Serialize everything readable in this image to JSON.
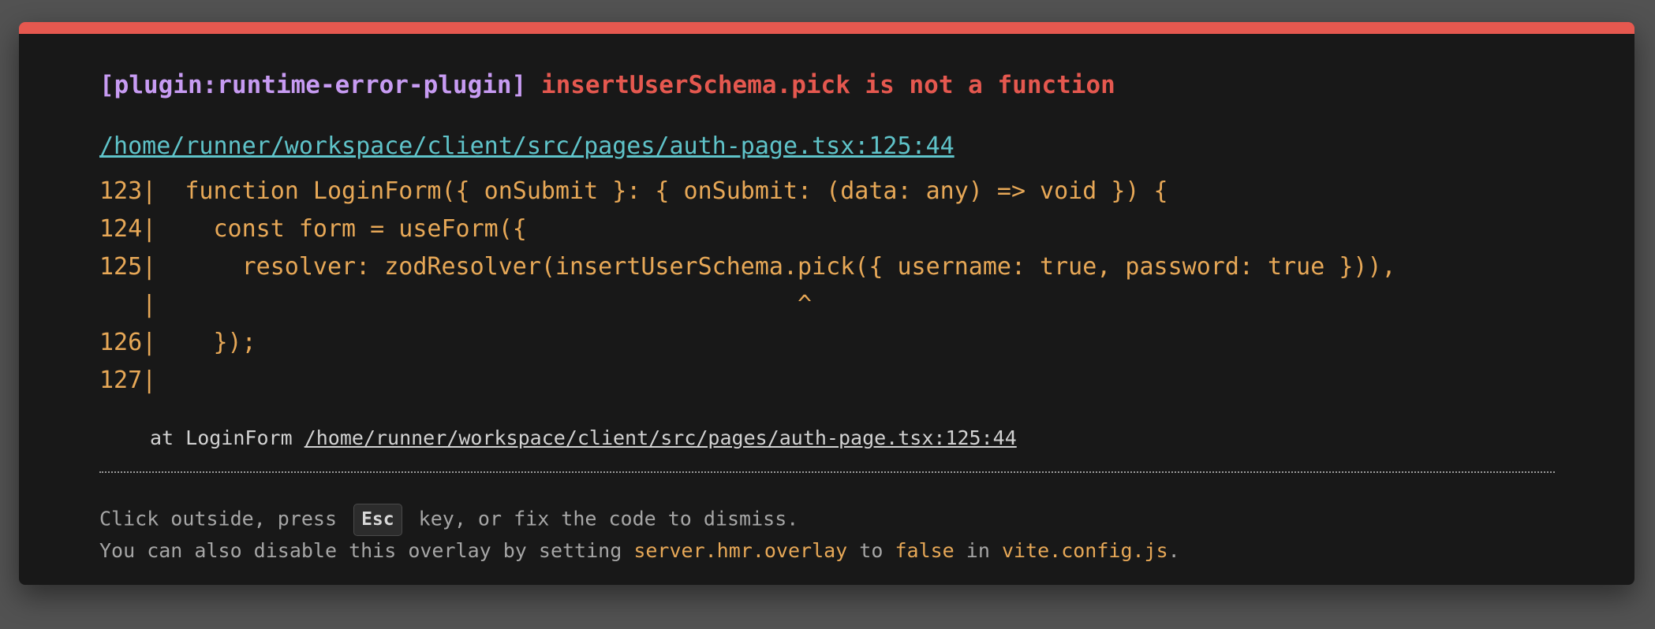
{
  "error": {
    "plugin": "[plugin:runtime-error-plugin]",
    "message": "insertUserSchema.pick is not a function",
    "file": "/home/runner/workspace/client/src/pages/auth-page.tsx:125:44"
  },
  "frame": [
    "123|  function LoginForm({ onSubmit }: { onSubmit: (data: any) => void }) {",
    "124|    const form = useForm({",
    "125|      resolver: zodResolver(insertUserSchema.pick({ username: true, password: true })),",
    "   |                                             ^",
    "126|    });",
    "127|"
  ],
  "stack": {
    "prefix": "at LoginForm ",
    "location": "/home/runner/workspace/client/src/pages/auth-page.tsx:125:44"
  },
  "tip": {
    "line1_before": "Click outside, press ",
    "key": "Esc",
    "line1_after": " key, or fix the code to dismiss.",
    "line2_before": "You can also disable this overlay by setting ",
    "setting": "server.hmr.overlay",
    "line2_middle": " to ",
    "value": "false",
    "line2_in": " in ",
    "config_file": "vite.config.js",
    "line2_end": "."
  },
  "colors": {
    "accent_bar": "#e5584f",
    "plugin": "#c79bf2",
    "error": "#e5584f",
    "link": "#5fc3c9",
    "code": "#e7a857",
    "background": "#181818"
  }
}
